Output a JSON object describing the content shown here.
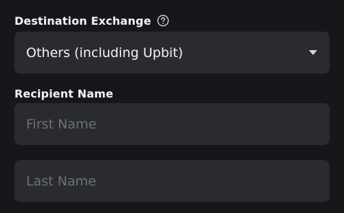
{
  "destination": {
    "label": "Destination Exchange",
    "help_icon": "question-circle-icon",
    "selected_value": "Others (including Upbit)",
    "dropdown_icon": "caret-down-icon"
  },
  "recipient": {
    "label": "Recipient Name",
    "first_name": {
      "value": "",
      "placeholder": "First Name"
    },
    "last_name": {
      "value": "",
      "placeholder": "Last Name"
    }
  },
  "colors": {
    "background": "#16171b",
    "field_background": "#292b30",
    "text": "#f3f4f6",
    "placeholder": "#6e7178"
  }
}
